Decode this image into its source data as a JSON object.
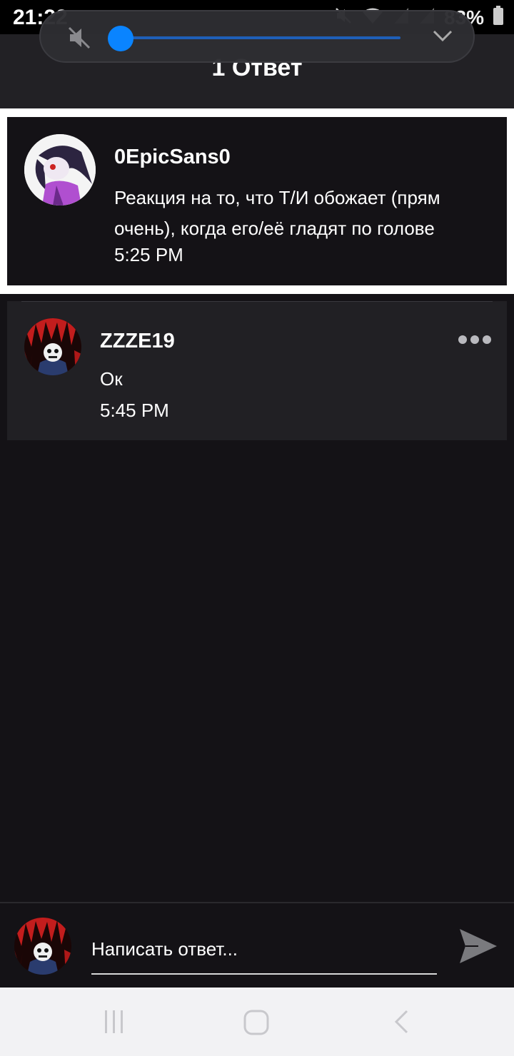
{
  "status_bar": {
    "time": "21:22",
    "battery": "83%"
  },
  "header": {
    "title": "1 Ответ"
  },
  "volume": {
    "level": 0.0,
    "accent": "#0a84ff",
    "muted": true
  },
  "post": {
    "username": "0EpicSans0",
    "text": "Реакция на то, что Т/И обожает (прям очень), когда его/её гладят по голове",
    "time": "5:25 PM"
  },
  "replies": [
    {
      "username": "ZZZE19",
      "text": "Ок",
      "time": "5:45 PM"
    }
  ],
  "composer": {
    "placeholder": "Написать ответ..."
  },
  "colors": {
    "background": "#141216",
    "card": "#212024",
    "header": "#222125"
  },
  "icons": [
    "mute-icon",
    "chevron-down-icon",
    "wifi-icon",
    "signal-icon",
    "battery-icon",
    "more-icon",
    "send-icon",
    "recent-apps-icon",
    "home-icon",
    "back-icon"
  ]
}
